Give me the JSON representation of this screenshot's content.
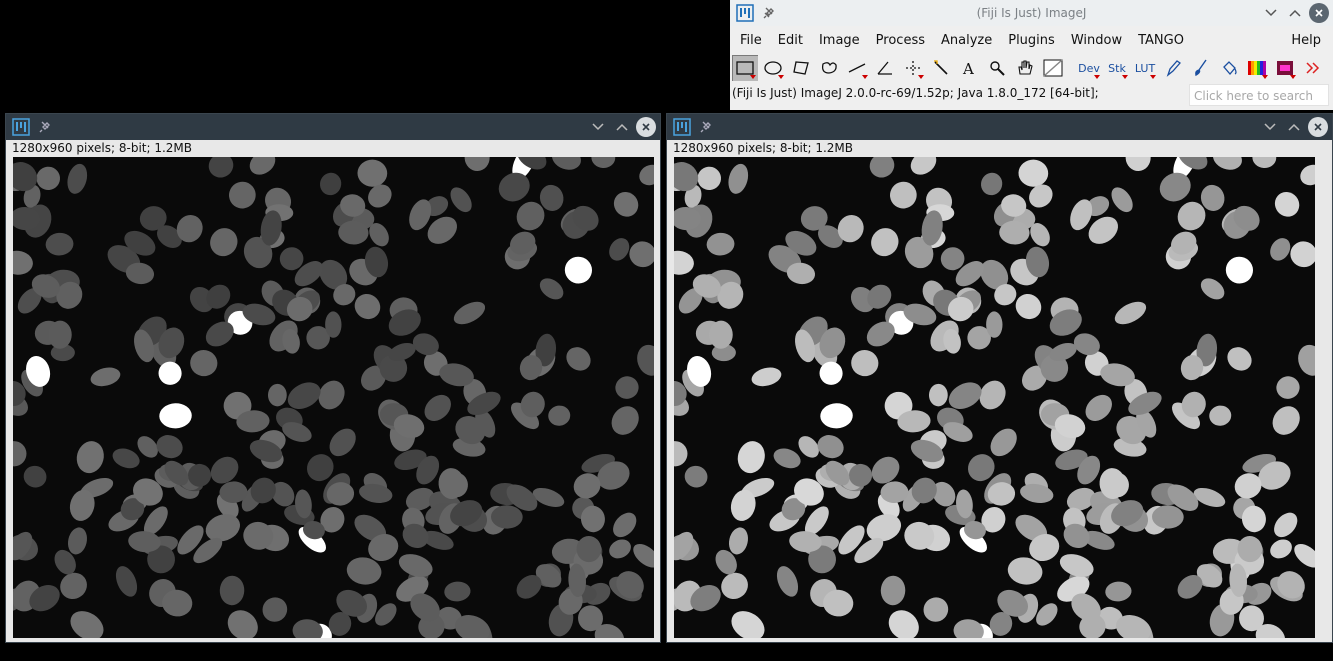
{
  "imagej": {
    "title": "(Fiji Is Just) ImageJ",
    "menus": [
      "File",
      "Edit",
      "Image",
      "Process",
      "Analyze",
      "Plugins",
      "Window",
      "TANGO"
    ],
    "help": "Help",
    "tools": [
      {
        "name": "rectangle-tool-icon"
      },
      {
        "name": "oval-tool-icon"
      },
      {
        "name": "polygon-tool-icon"
      },
      {
        "name": "freehand-tool-icon"
      },
      {
        "name": "line-tool-icon"
      },
      {
        "name": "angle-tool-icon"
      },
      {
        "name": "point-tool-icon"
      },
      {
        "name": "wand-tool-icon"
      },
      {
        "name": "text-tool-icon"
      },
      {
        "name": "magnifier-tool-icon"
      },
      {
        "name": "hand-tool-icon"
      },
      {
        "name": "color-picker-icon"
      }
    ],
    "tool_text": {
      "dev": "Dev",
      "stk": "Stk",
      "lut": "LUT"
    },
    "status": "(Fiji Is Just) ImageJ 2.0.0-rc-69/1.52p; Java 1.8.0_172 [64-bit];",
    "search_placeholder": "Click here to search"
  },
  "image_left": {
    "info": "1280x960 pixels; 8-bit; 1.2MB",
    "brightness": 0.45
  },
  "image_right": {
    "info": "1280x960 pixels; 8-bit; 1.2MB",
    "brightness": 0.85
  },
  "colors": {
    "titlebar_dark": "#2f3a44",
    "titlebar_light": "#eceff1",
    "accent_blue": "#4aa3df"
  }
}
